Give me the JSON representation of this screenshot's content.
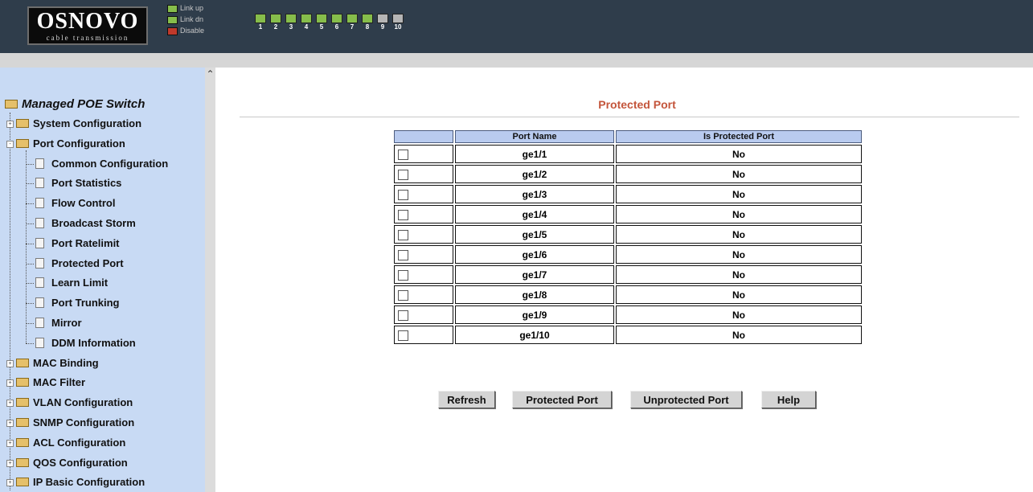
{
  "header": {
    "logo_main": "OSNOVO",
    "logo_sub": "cable transmission",
    "legend": [
      {
        "label": "Link up",
        "color": "#86bd4b"
      },
      {
        "label": "Link dn",
        "color": "#86bd4b"
      },
      {
        "label": "Disable",
        "color": "#c0392b"
      }
    ],
    "ports": [
      {
        "num": "1",
        "type": "copper"
      },
      {
        "num": "2",
        "type": "copper"
      },
      {
        "num": "3",
        "type": "copper"
      },
      {
        "num": "4",
        "type": "copper"
      },
      {
        "num": "5",
        "type": "copper"
      },
      {
        "num": "6",
        "type": "copper"
      },
      {
        "num": "7",
        "type": "copper"
      },
      {
        "num": "8",
        "type": "copper"
      },
      {
        "num": "9",
        "type": "fiber"
      },
      {
        "num": "10",
        "type": "fiber"
      }
    ]
  },
  "sidebar": {
    "root": "Managed POE Switch",
    "items": [
      {
        "label": "System Configuration",
        "kind": "folder",
        "level": 1
      },
      {
        "label": "Port Configuration",
        "kind": "folder-open",
        "level": 1
      },
      {
        "label": "Common Configuration",
        "kind": "page",
        "level": 2
      },
      {
        "label": "Port Statistics",
        "kind": "page",
        "level": 2
      },
      {
        "label": "Flow Control",
        "kind": "page",
        "level": 2
      },
      {
        "label": "Broadcast Storm",
        "kind": "page",
        "level": 2
      },
      {
        "label": "Port Ratelimit",
        "kind": "page",
        "level": 2
      },
      {
        "label": "Protected Port",
        "kind": "page",
        "level": 2
      },
      {
        "label": "Learn Limit",
        "kind": "page",
        "level": 2
      },
      {
        "label": "Port Trunking",
        "kind": "page",
        "level": 2
      },
      {
        "label": "Mirror",
        "kind": "page",
        "level": 2
      },
      {
        "label": "DDM Information",
        "kind": "page",
        "level": 2
      },
      {
        "label": "MAC Binding",
        "kind": "folder",
        "level": 1
      },
      {
        "label": "MAC Filter",
        "kind": "folder",
        "level": 1
      },
      {
        "label": "VLAN Configuration",
        "kind": "folder",
        "level": 1
      },
      {
        "label": "SNMP Configuration",
        "kind": "folder",
        "level": 1
      },
      {
        "label": "ACL Configuration",
        "kind": "folder",
        "level": 1
      },
      {
        "label": "QOS Configuration",
        "kind": "folder",
        "level": 1
      },
      {
        "label": "IP Basic Configuration",
        "kind": "folder",
        "level": 1
      }
    ]
  },
  "main": {
    "title": "Protected Port",
    "columns": [
      "",
      "Port Name",
      "Is Protected Port"
    ],
    "rows": [
      {
        "port": "ge1/1",
        "protected": "No",
        "checked": false
      },
      {
        "port": "ge1/2",
        "protected": "No",
        "checked": false
      },
      {
        "port": "ge1/3",
        "protected": "No",
        "checked": false
      },
      {
        "port": "ge1/4",
        "protected": "No",
        "checked": false
      },
      {
        "port": "ge1/5",
        "protected": "No",
        "checked": false
      },
      {
        "port": "ge1/6",
        "protected": "No",
        "checked": false
      },
      {
        "port": "ge1/7",
        "protected": "No",
        "checked": false
      },
      {
        "port": "ge1/8",
        "protected": "No",
        "checked": false
      },
      {
        "port": "ge1/9",
        "protected": "No",
        "checked": false
      },
      {
        "port": "ge1/10",
        "protected": "No",
        "checked": false
      }
    ],
    "buttons": {
      "refresh": "Refresh",
      "protected": "Protected Port",
      "unprotected": "Unprotected Port",
      "help": "Help"
    }
  }
}
